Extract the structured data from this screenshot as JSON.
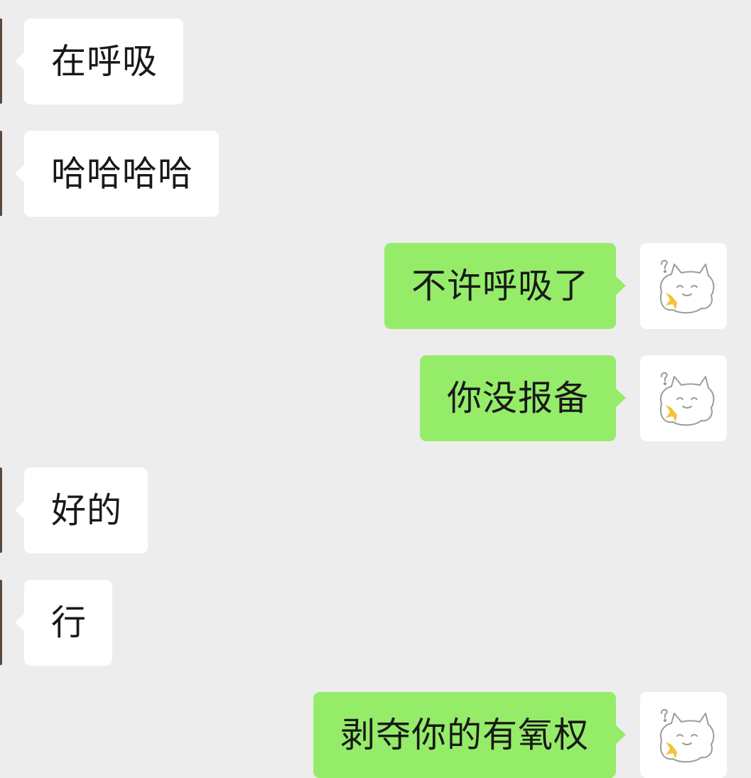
{
  "messages": [
    {
      "side": "in",
      "text": "在呼吸"
    },
    {
      "side": "in",
      "text": "哈哈哈哈"
    },
    {
      "side": "out",
      "text": "不许呼吸了"
    },
    {
      "side": "out",
      "text": "你没报备"
    },
    {
      "side": "in",
      "text": "好的"
    },
    {
      "side": "in",
      "text": "行"
    },
    {
      "side": "out",
      "text": "剥夺你的有氧权"
    }
  ],
  "avatar": {
    "icon": "cat-avatar-icon"
  },
  "colors": {
    "background": "#ededed",
    "incoming_bubble": "#ffffff",
    "outgoing_bubble": "#95ec69",
    "text": "#191919"
  }
}
